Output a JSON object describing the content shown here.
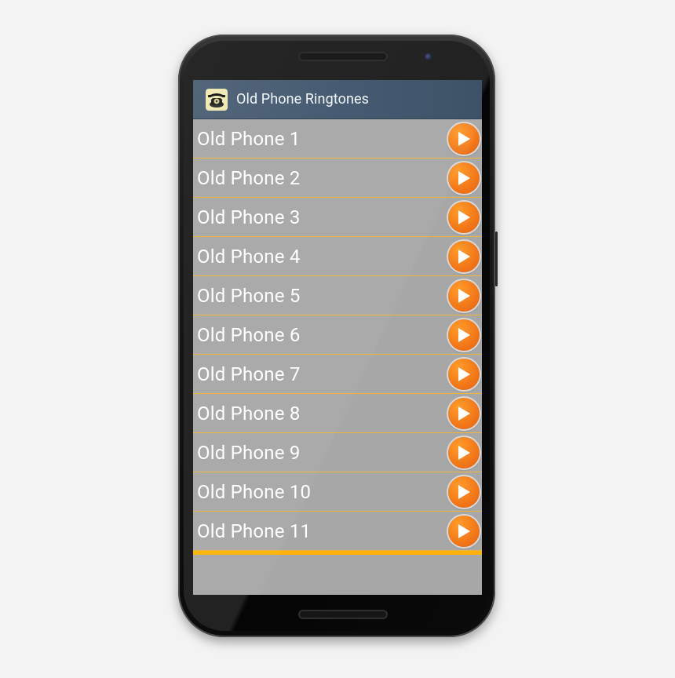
{
  "app": {
    "title": "Old Phone Ringtones",
    "icon": "vintage-telephone-icon"
  },
  "ringtones": [
    {
      "label": "Old Phone 1",
      "action_icon": "play-icon"
    },
    {
      "label": "Old Phone 2",
      "action_icon": "play-icon"
    },
    {
      "label": "Old Phone 3",
      "action_icon": "play-icon"
    },
    {
      "label": "Old Phone 4",
      "action_icon": "play-icon"
    },
    {
      "label": "Old Phone 5",
      "action_icon": "play-icon"
    },
    {
      "label": "Old Phone 6",
      "action_icon": "play-icon"
    },
    {
      "label": "Old Phone 7",
      "action_icon": "play-icon"
    },
    {
      "label": "Old Phone 8",
      "action_icon": "play-icon"
    },
    {
      "label": "Old Phone 9",
      "action_icon": "play-icon"
    },
    {
      "label": "Old Phone 10",
      "action_icon": "play-icon"
    },
    {
      "label": "Old Phone 11",
      "action_icon": "play-icon"
    }
  ],
  "colors": {
    "action_bar": "#3f5469",
    "list_background": "#a7a7a7",
    "separator": "#f0b43a",
    "list_end_bar": "#ffb300",
    "play_button": "#f37a1a"
  }
}
